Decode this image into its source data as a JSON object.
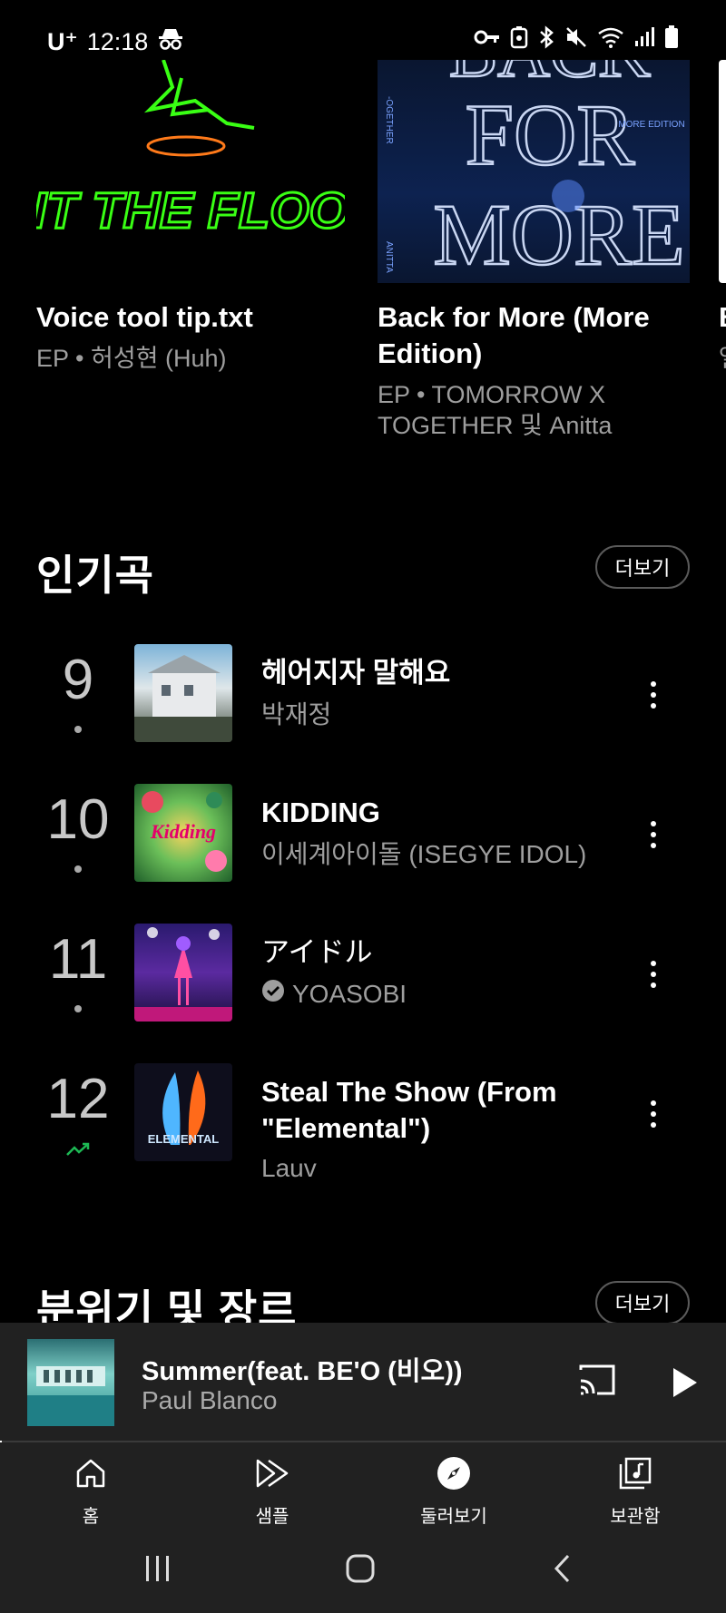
{
  "status_bar": {
    "carrier": "U⁺",
    "time": "12:18"
  },
  "albums": [
    {
      "title": "Voice tool tip.txt",
      "subtitle": "EP • 허성현 (Huh)",
      "art_colors": [
        "#000000",
        "#39ff14"
      ]
    },
    {
      "title": "Back for More (More Edition)",
      "subtitle": "EP • TOMORROW X TOGETHER 및 Anitta",
      "art_colors": [
        "#0a1630",
        "#9fb8e8"
      ]
    },
    {
      "title": "B",
      "subtitle": "앨",
      "art_colors": [
        "#ffffff",
        "#ffffff"
      ]
    }
  ],
  "art_text": {
    "album1": "HIT THE FLOOR",
    "album2_lines": [
      "BACK",
      "FOR",
      "MORE"
    ],
    "album2_edition": "MORE EDITION",
    "album2_side_top": "-OGETHER",
    "album2_side_bottom": "ANITTA",
    "song10": "Kidding",
    "song12": "ELEMENTAL"
  },
  "popular_section": {
    "title": "인기곡",
    "more_label": "더보기",
    "songs": [
      {
        "rank": "9",
        "title": "헤어지자 말해요",
        "artist": "박재정",
        "trend": "same",
        "verified": false
      },
      {
        "rank": "10",
        "title": "KIDDING",
        "artist": "이세계아이돌 (ISEGYE IDOL)",
        "trend": "same",
        "verified": false
      },
      {
        "rank": "11",
        "title": "アイドル",
        "artist": "YOASOBI",
        "trend": "same",
        "verified": true
      },
      {
        "rank": "12",
        "title": "Steal The Show (From \"Elemental\")",
        "artist": "Lauv",
        "trend": "up",
        "verified": false
      }
    ]
  },
  "mood_section": {
    "title": "분위기 및 장르",
    "more_label": "더보기"
  },
  "now_playing": {
    "title": "Summer(feat. BE'O (비오))",
    "artist": "Paul Blanco",
    "progress": 0.003
  },
  "bottom_nav": {
    "items": [
      {
        "label": "홈",
        "icon": "home-icon",
        "active": false
      },
      {
        "label": "샘플",
        "icon": "samples-icon",
        "active": false
      },
      {
        "label": "둘러보기",
        "icon": "explore-icon",
        "active": true
      },
      {
        "label": "보관함",
        "icon": "library-icon",
        "active": false
      }
    ]
  },
  "colors": {
    "background": "#000000",
    "surface": "#212121",
    "secondary_text": "#9e9e9e",
    "trend_up": "#1db954"
  }
}
